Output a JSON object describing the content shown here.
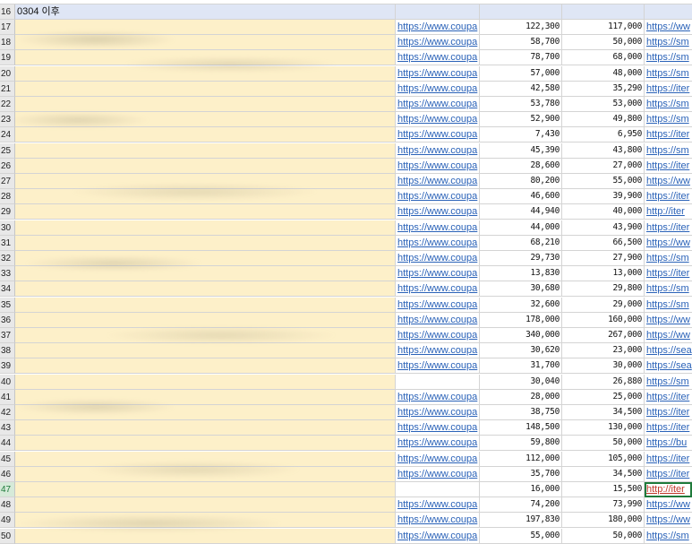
{
  "section_label": "0304 이후",
  "rows": [
    {
      "num": "17",
      "link": "https://www.coupa",
      "price": "122,300",
      "sale": "117,000",
      "url2": "https://ww"
    },
    {
      "num": "18",
      "link": "https://www.coupa",
      "price": "58,700",
      "sale": "50,000",
      "url2": "https://sm"
    },
    {
      "num": "19",
      "link": "https://www.coupa",
      "price": "78,700",
      "sale": "68,000",
      "url2": "https://sm"
    },
    {
      "num": "20",
      "link": "https://www.coupa",
      "price": "57,000",
      "sale": "48,000",
      "url2": "https://sm"
    },
    {
      "num": "21",
      "link": "https://www.coupa",
      "price": "42,580",
      "sale": "35,290",
      "url2": "https://iter"
    },
    {
      "num": "22",
      "link": "https://www.coupa",
      "price": "53,780",
      "sale": "53,000",
      "url2": "https://sm"
    },
    {
      "num": "23",
      "link": "https://www.coupa",
      "price": "52,900",
      "sale": "49,800",
      "url2": "https://sm"
    },
    {
      "num": "24",
      "link": "https://www.coupa",
      "price": "7,430",
      "sale": "6,950",
      "url2": "https://iter"
    },
    {
      "num": "25",
      "link": "https://www.coupa",
      "price": "45,390",
      "sale": "43,800",
      "url2": "https://sm"
    },
    {
      "num": "26",
      "link": "https://www.coupa",
      "price": "28,600",
      "sale": "27,000",
      "url2": "https://iter"
    },
    {
      "num": "27",
      "link": "https://www.coupa",
      "price": "80,200",
      "sale": "55,000",
      "url2": "https://ww"
    },
    {
      "num": "28",
      "link": "https://www.coupa",
      "price": "46,600",
      "sale": "39,900",
      "url2": "https://iter"
    },
    {
      "num": "29",
      "link": "https://www.coupa",
      "price": "44,940",
      "sale": "40,000",
      "url2": "http://iter"
    },
    {
      "num": "30",
      "link": "https://www.coupa",
      "price": "44,000",
      "sale": "43,900",
      "url2": "https://iter"
    },
    {
      "num": "31",
      "link": "https://www.coupa",
      "price": "68,210",
      "sale": "66,500",
      "url2": "https://ww"
    },
    {
      "num": "32",
      "link": "https://www.coupa",
      "price": "29,730",
      "sale": "27,900",
      "url2": "https://sm"
    },
    {
      "num": "33",
      "link": "https://www.coupa",
      "price": "13,830",
      "sale": "13,000",
      "url2": "https://iter"
    },
    {
      "num": "34",
      "link": "https://www.coupa",
      "price": "30,680",
      "sale": "29,800",
      "url2": "https://sm"
    },
    {
      "num": "35",
      "link": "https://www.coupa",
      "price": "32,600",
      "sale": "29,000",
      "url2": "https://sm"
    },
    {
      "num": "36",
      "link": "https://www.coupa",
      "price": "178,000",
      "sale": "160,000",
      "url2": "https://ww"
    },
    {
      "num": "37",
      "link": "https://www.coupa",
      "price": "340,000",
      "sale": "267,000",
      "url2": "https://ww"
    },
    {
      "num": "38",
      "link": "https://www.coupa",
      "price": "30,620",
      "sale": "23,000",
      "url2": "https://sea"
    },
    {
      "num": "39",
      "link": "https://www.coupa",
      "price": "31,700",
      "sale": "30,000",
      "url2": "https://sea"
    },
    {
      "num": "40",
      "link": "",
      "price": "30,040",
      "sale": "26,880",
      "url2": "https://sm"
    },
    {
      "num": "41",
      "link": "https://www.coupa",
      "price": "28,000",
      "sale": "25,000",
      "url2": "https://iter"
    },
    {
      "num": "42",
      "link": "https://www.coupa",
      "price": "38,750",
      "sale": "34,500",
      "url2": "https://iter"
    },
    {
      "num": "43",
      "link": "https://www.coupa",
      "price": "148,500",
      "sale": "130,000",
      "url2": "https://iter"
    },
    {
      "num": "44",
      "link": "https://www.coupa",
      "price": "59,800",
      "sale": "50,000",
      "url2": "https://bu"
    },
    {
      "num": "45",
      "link": "https://www.coupa",
      "price": "112,000",
      "sale": "105,000",
      "url2": "https://iter"
    },
    {
      "num": "46",
      "link": "https://www.coupa",
      "price": "35,700",
      "sale": "34,500",
      "url2": "https://iter"
    },
    {
      "num": "47",
      "link": "",
      "price": "16,000",
      "sale": "15,500",
      "url2": "http://iter"
    },
    {
      "num": "48",
      "link": "https://www.coupa",
      "price": "74,200",
      "sale": "73,990",
      "url2": "https://ww"
    },
    {
      "num": "49",
      "link": "https://www.coupa",
      "price": "197,830",
      "sale": "180,000",
      "url2": "https://ww"
    },
    {
      "num": "50",
      "link": "https://www.coupa",
      "price": "55,000",
      "sale": "50,000",
      "url2": "https://sm"
    }
  ],
  "header_row_num": "16",
  "selected_row": "47",
  "colors": {
    "cell_fill": "#fdf0c9",
    "link": "#2a62b8",
    "header_fill": "#dfe6f5",
    "selection": "#1f7a3b"
  }
}
